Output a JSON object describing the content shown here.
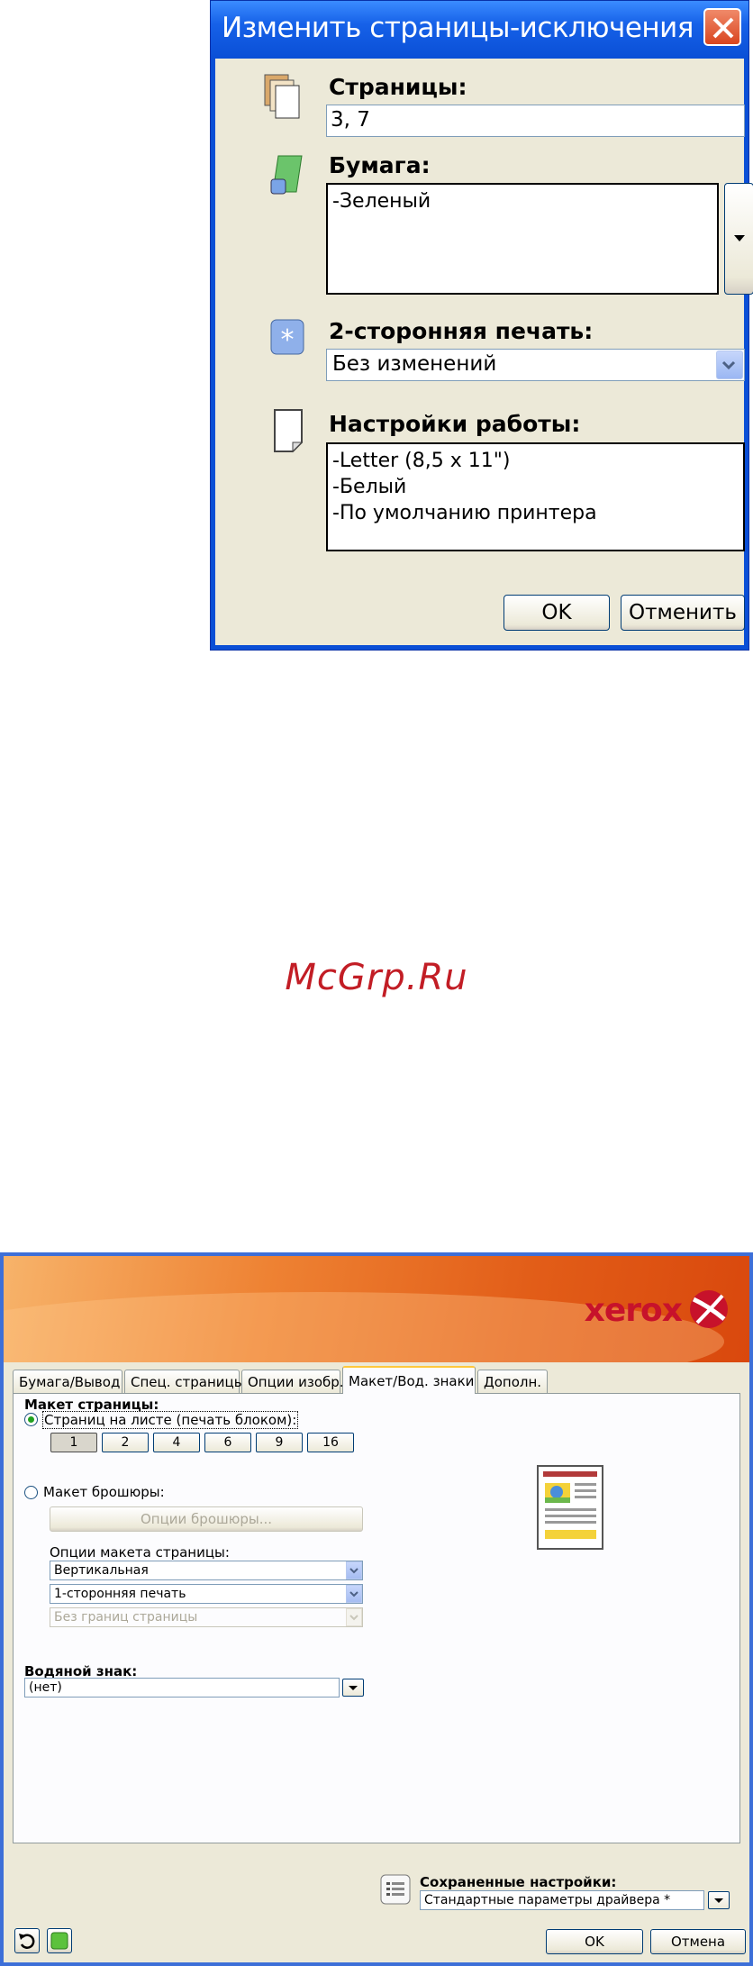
{
  "dialog1": {
    "title": "Изменить страницы-исключения",
    "pages": {
      "label": "Страницы:",
      "value": "3, 7"
    },
    "paper": {
      "label": "Бумага:",
      "items": [
        "-Зеленый"
      ]
    },
    "duplex": {
      "label": "2-сторонняя печать:",
      "value": "Без изменений"
    },
    "job_settings": {
      "label": "Настройки работы:",
      "items": [
        "-Letter (8,5 x 11\")",
        "-Белый",
        "-По умолчанию принтера"
      ]
    },
    "ok_label": "OK",
    "cancel_label": "Отменить"
  },
  "watermark_text": "McGrp.Ru",
  "dialog2": {
    "brand": "xerox",
    "tabs": [
      "Бумага/Вывод",
      "Спец. страницы",
      "Опции изобр.",
      "Макет/Вод. знаки",
      "Дополн."
    ],
    "active_tab": 3,
    "page_layout": {
      "heading": "Макет страницы:",
      "pages_per_sheet_label": "Страниц на листе (печать блоком):",
      "pages_per_sheet_options": [
        "1",
        "2",
        "4",
        "6",
        "9",
        "16"
      ],
      "selected_option": "1",
      "booklet_label": "Макет брошюры:",
      "booklet_options_button": "Опции брошюры...",
      "options_heading": "Опции макета страницы:",
      "orientation": "Вертикальная",
      "sides": "1-сторонняя печать",
      "borders": "Без границ страницы"
    },
    "watermark": {
      "heading": "Водяной знак:",
      "value": "(нет)"
    },
    "saved_settings": {
      "label": "Сохраненные настройки:",
      "value": "Стандартные параметры драйвера *"
    },
    "ok_label": "OK",
    "cancel_label": "Отмена"
  }
}
